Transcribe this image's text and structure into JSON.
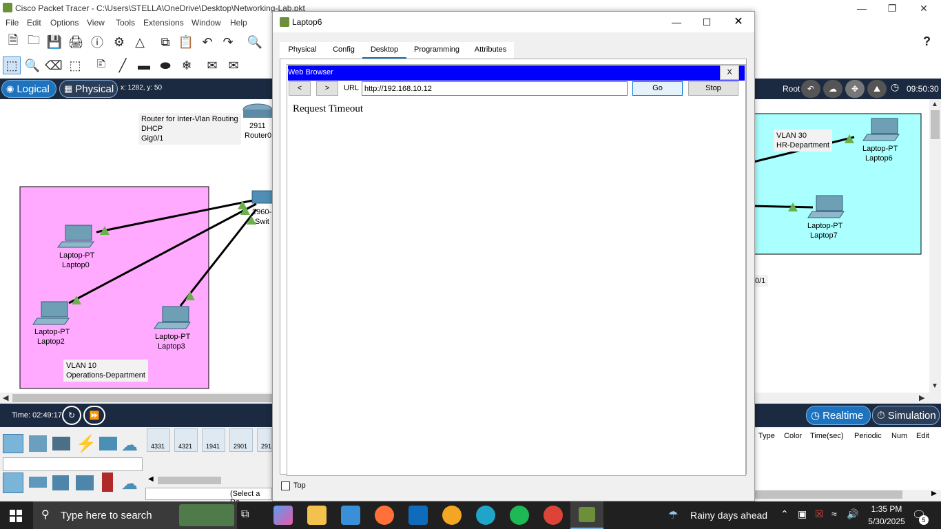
{
  "app": {
    "title": "Cisco Packet Tracer - C:\\Users\\STELLA\\OneDrive\\Desktop\\Networking-Lab.pkt",
    "menu": [
      "File",
      "Edit",
      "Options",
      "View",
      "Tools",
      "Extensions",
      "Window",
      "Help"
    ],
    "mode_logical": "Logical",
    "mode_physical": "Physical",
    "coords": "x: 1282, y: 50",
    "root_label": "Root",
    "clock": "09:50:30",
    "time_label": "Time: 02:49:17",
    "realtime_label": "Realtime",
    "simulation_label": "Simulation",
    "help_icon": "?"
  },
  "topology": {
    "router_note": [
      "Router for Inter-Vlan Routing",
      "DHCP",
      "Gig0/1"
    ],
    "router_model": "2911",
    "router_name": "Router0",
    "switch_model": "2960-",
    "switch_name": "Swit",
    "vlan10_note": [
      "VLAN 10",
      "Operations-Department"
    ],
    "vlan30_note": [
      "VLAN 30",
      "HR-Department"
    ],
    "fragment_label": "0/1",
    "laptops": [
      {
        "type": "Laptop-PT",
        "name": "Laptop0"
      },
      {
        "type": "Laptop-PT",
        "name": "Laptop2"
      },
      {
        "type": "Laptop-PT",
        "name": "Laptop3"
      },
      {
        "type": "Laptop-PT",
        "name": "Laptop6"
      },
      {
        "type": "Laptop-PT",
        "name": "Laptop7"
      }
    ],
    "colors": {
      "vlan10": "#ffaaff",
      "vlan30": "#aaffff",
      "link": "#000000",
      "port_up": "#6ab04c"
    }
  },
  "device_panel": {
    "router_models": [
      "4331",
      "4321",
      "1941",
      "2901",
      "291"
    ],
    "select_hint": "(Select a De",
    "pdu_headers": [
      "Type",
      "Color",
      "Time(sec)",
      "Periodic",
      "Num",
      "Edit"
    ]
  },
  "dialog": {
    "title": "Laptop6",
    "tabs": [
      "Physical",
      "Config",
      "Desktop",
      "Programming",
      "Attributes"
    ],
    "active_tab": "Desktop",
    "browser_title": "Web Browser",
    "close_label": "X",
    "back_label": "<",
    "forward_label": ">",
    "url_label": "URL",
    "url_value": "http://192.168.10.12",
    "go_label": "Go",
    "stop_label": "Stop",
    "page_content": "Request Timeout",
    "top_checkbox_label": "Top"
  },
  "taskbar": {
    "search_placeholder": "Type here to search",
    "weather": "Rainy days ahead",
    "time": "1:35 PM",
    "date": "5/30/2025",
    "notification_count": "5"
  }
}
